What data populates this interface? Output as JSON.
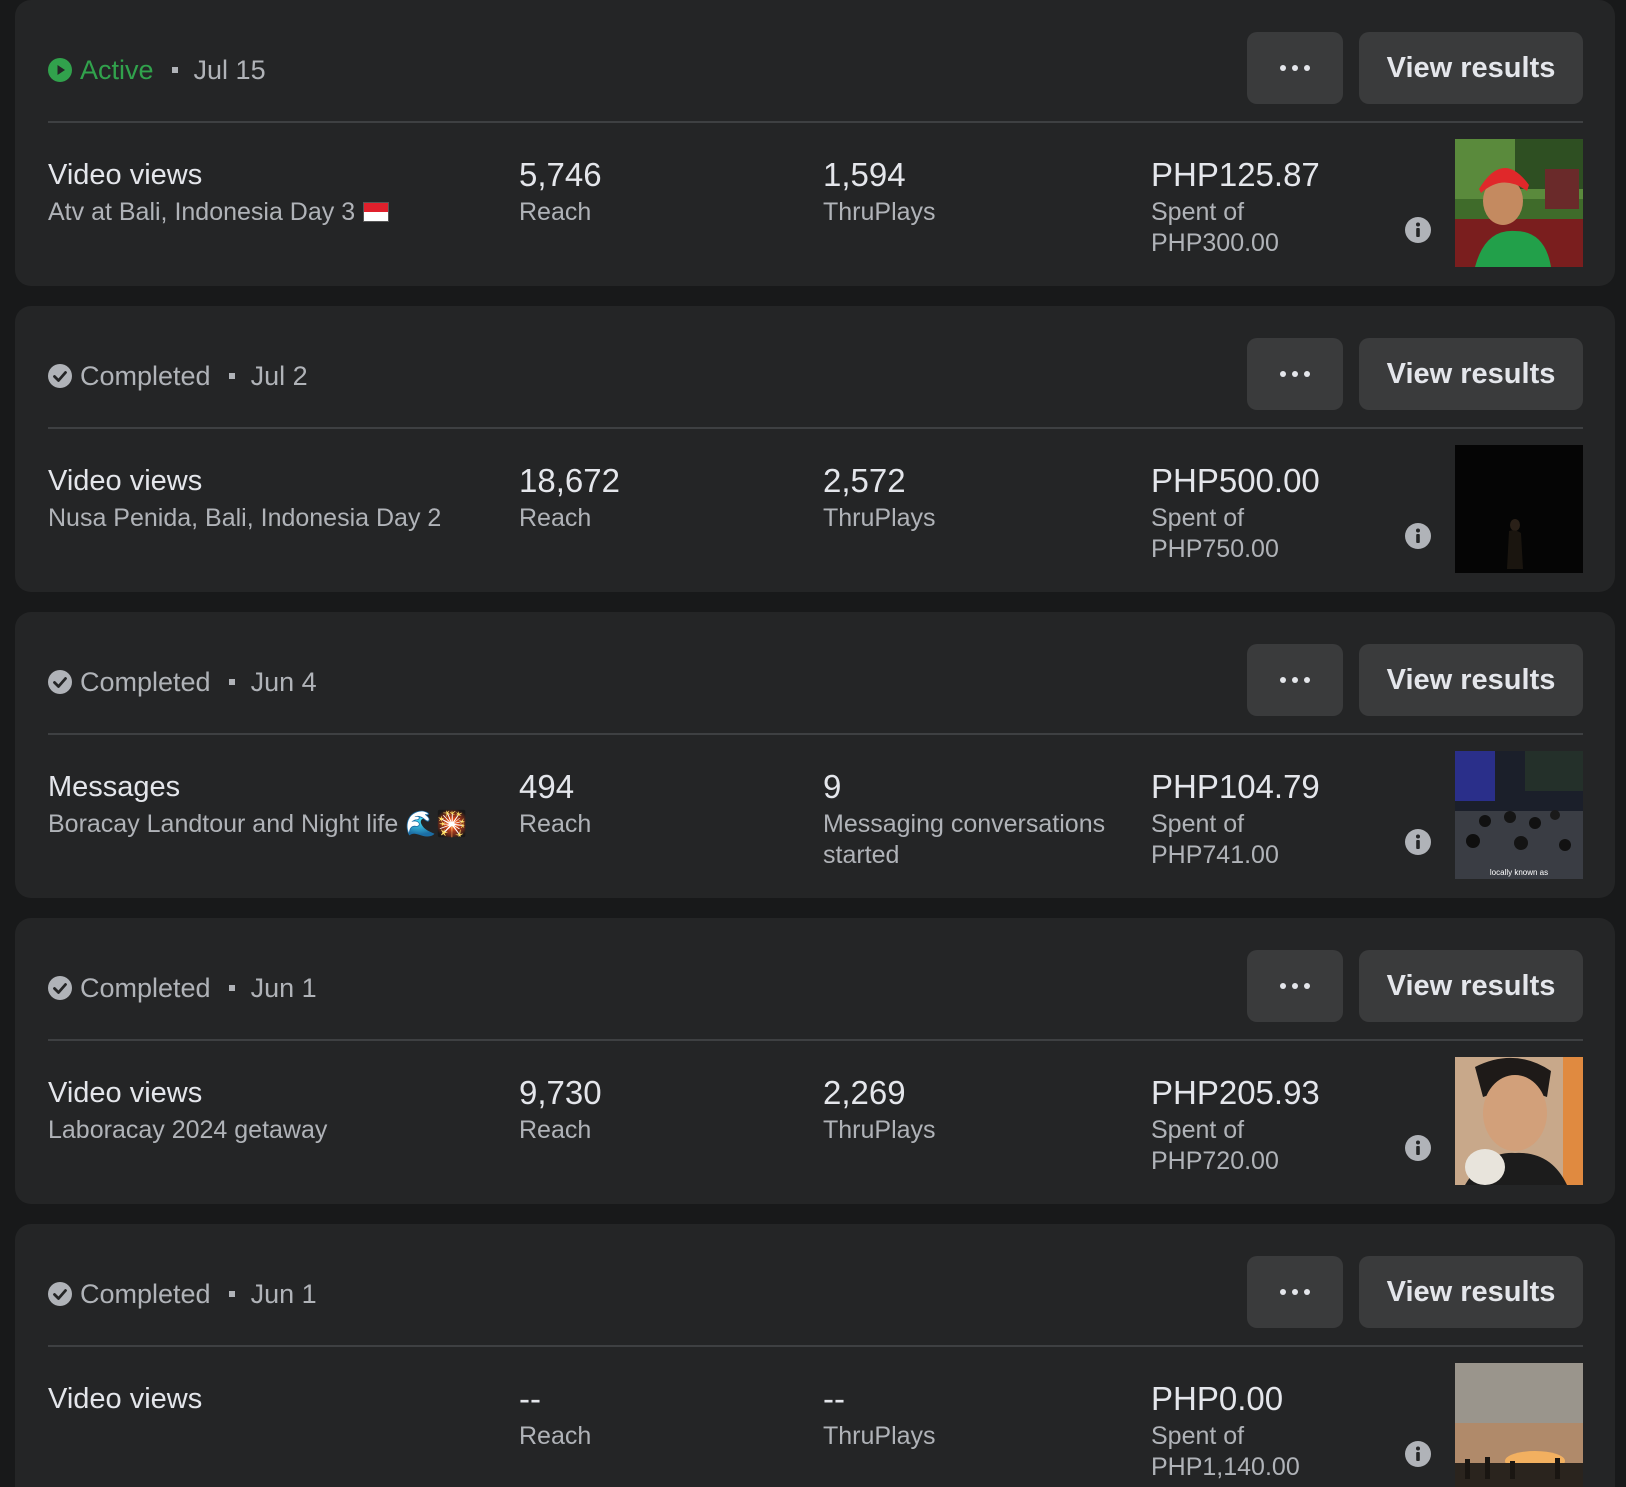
{
  "campaigns": [
    {
      "status": "Active",
      "status_kind": "active",
      "date": "Jul 15",
      "objective": "Video views",
      "name": "Atv at Bali, Indonesia Day 3",
      "name_emoji": "indonesia-flag",
      "metric1_value": "5,746",
      "metric1_label": "Reach",
      "metric2_value": "1,594",
      "metric2_label": "ThruPlays",
      "spent": "PHP125.87",
      "spent_label": "Spent of",
      "budget": "PHP300.00",
      "thumbnail": "atv-rider-photo"
    },
    {
      "status": "Completed",
      "status_kind": "completed",
      "date": "Jul 2",
      "objective": "Video views",
      "name": "Nusa Penida, Bali, Indonesia Day 2",
      "metric1_value": "18,672",
      "metric1_label": "Reach",
      "metric2_value": "2,572",
      "metric2_label": "ThruPlays",
      "spent": "PHP500.00",
      "spent_label": "Spent of",
      "budget": "PHP750.00",
      "thumbnail": "dark-figure-photo"
    },
    {
      "status": "Completed",
      "status_kind": "completed",
      "date": "Jun 4",
      "objective": "Messages",
      "name": "Boracay Landtour and Night life 🌊🎇",
      "metric1_value": "494",
      "metric1_label": "Reach",
      "metric2_value": "9",
      "metric2_label": "Messaging conversations started",
      "spent": "PHP104.79",
      "spent_label": "Spent of",
      "budget": "PHP741.00",
      "thumbnail": "night-crowd-photo",
      "thumbnail_caption": "locally known as"
    },
    {
      "status": "Completed",
      "status_kind": "completed",
      "date": "Jun 1",
      "objective": "Video views",
      "name": "Laboracay 2024 getaway",
      "metric1_value": "9,730",
      "metric1_label": "Reach",
      "metric2_value": "2,269",
      "metric2_label": "ThruPlays",
      "spent": "PHP205.93",
      "spent_label": "Spent of",
      "budget": "PHP720.00",
      "thumbnail": "man-portrait-photo"
    },
    {
      "status": "Completed",
      "status_kind": "completed",
      "date": "Jun 1",
      "objective": "Video views",
      "name": "",
      "metric1_value": "--",
      "metric1_label": "Reach",
      "metric2_value": "--",
      "metric2_label": "ThruPlays",
      "spent": "PHP0.00",
      "spent_label": "Spent of",
      "budget": "PHP1,140.00",
      "thumbnail": "sunset-beach-photo"
    }
  ],
  "actions": {
    "view_results_label": "View results",
    "more_icon": "more-horizontal-icon"
  },
  "colors": {
    "background": "#18191a",
    "card": "#242526",
    "button": "#3a3b3c",
    "active_green": "#31a24c",
    "secondary_text": "#b0b3b8"
  }
}
